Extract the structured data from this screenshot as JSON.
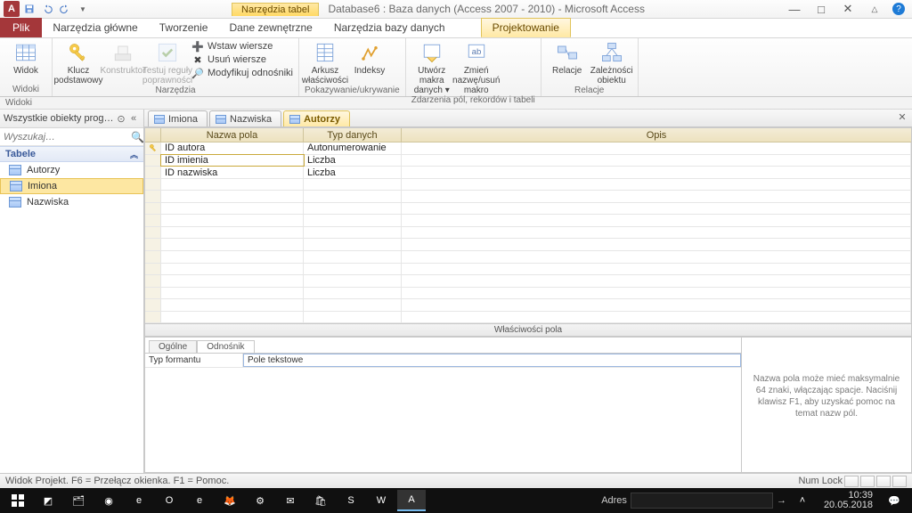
{
  "title": "Database6 : Baza danych (Access 2007 - 2010)  -  Microsoft Access",
  "tool_context": "Narzędzia tabel",
  "ribbon_tabs": {
    "file": "Plik",
    "t0": "Narzędzia główne",
    "t1": "Tworzenie",
    "t2": "Dane zewnętrzne",
    "t3": "Narzędzia bazy danych",
    "active": "Projektowanie"
  },
  "ribbon": {
    "g_views": {
      "label": "Widoki",
      "btn": "Widok"
    },
    "g_tools": {
      "label": "Narzędzia",
      "pk": "Klucz\npodstawowy",
      "builder": "Konstruktor",
      "test": "Testuj reguły\npoprawności",
      "ins": "Wstaw wiersze",
      "del": "Usuń wiersze",
      "mod": "Modyfikuj odnośniki"
    },
    "g_showhide": {
      "label": "Pokazywanie/ukrywanie",
      "sheet": "Arkusz\nwłaściwości",
      "idx": "Indeksy"
    },
    "g_events": {
      "label": "Zdarzenia pól, rekordów i tabeli",
      "macro": "Utwórz makra\ndanych ▾",
      "rename": "Zmień nazwę/usuń\nmakro"
    },
    "g_rel": {
      "label": "Relacje",
      "rel": "Relacje",
      "dep": "Zależności\nobiektu"
    }
  },
  "sub_label": "Widoki",
  "nav": {
    "header": "Wszystkie obiekty progra…",
    "search_placeholder": "Wyszukaj…",
    "category": "Tabele",
    "items": [
      "Autorzy",
      "Imiona",
      "Nazwiska"
    ],
    "selected": 1
  },
  "doc_tabs": [
    "Imiona",
    "Nazwiska",
    "Autorzy"
  ],
  "doc_active": 2,
  "design": {
    "head": {
      "name": "Nazwa pola",
      "type": "Typ danych",
      "desc": "Opis"
    },
    "rows": [
      {
        "pk": true,
        "name": "ID autora",
        "type": "Autonumerowanie"
      },
      {
        "pk": false,
        "name": "ID imienia",
        "type": "Liczba",
        "current": true
      },
      {
        "pk": false,
        "name": "ID nazwiska",
        "type": "Liczba"
      }
    ]
  },
  "prop": {
    "split_label": "Właściwości pola",
    "tabs": {
      "general": "Ogólne",
      "lookup": "Odnośnik"
    },
    "row": {
      "name": "Typ formantu",
      "value": "Pole tekstowe"
    },
    "help": "Nazwa pola może mieć maksymalnie 64 znaki, włączając spacje. Naciśnij klawisz F1, aby uzyskać pomoc na temat nazw pól."
  },
  "status": {
    "left": "Widok Projekt. F6 = Przełącz okienka. F1 = Pomoc.",
    "numlock": "Num Lock"
  },
  "taskbar": {
    "addr_label": "Adres",
    "time": "10:39",
    "date": "20.05.2018"
  }
}
